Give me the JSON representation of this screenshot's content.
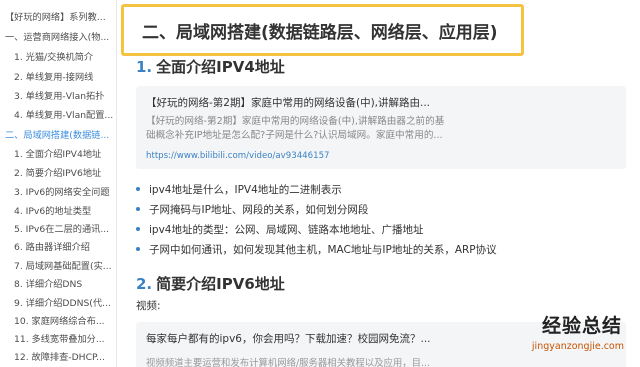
{
  "sidebar": {
    "items": [
      {
        "label": "【好玩的网络】系列教...",
        "level": 1,
        "active": false
      },
      {
        "label": "一、运营商网络接入(物...",
        "level": 1,
        "active": false
      },
      {
        "label": "1. 光猫/交换机简介",
        "level": 2,
        "active": false
      },
      {
        "label": "2. 单线复用-接网线",
        "level": 2,
        "active": false
      },
      {
        "label": "3. 单线复用-Vlan拓扑",
        "level": 2,
        "active": false
      },
      {
        "label": "4. 单线复用-Vlan配置...",
        "level": 2,
        "active": false
      },
      {
        "label": "二、局域网搭建(数据链...",
        "level": 1,
        "active": true
      },
      {
        "label": "1. 全面介绍IPV4地址",
        "level": 2,
        "active": false
      },
      {
        "label": "2. 简要介绍IPV6地址",
        "level": 2,
        "active": false
      },
      {
        "label": "3. IPv6的网络安全问题",
        "level": 2,
        "active": false
      },
      {
        "label": "4. IPv6的地址类型",
        "level": 2,
        "active": false
      },
      {
        "label": "5. IPv6在二层的通讯...",
        "level": 2,
        "active": false
      },
      {
        "label": "6. 路由器详细介绍",
        "level": 2,
        "active": false
      },
      {
        "label": "7. 局域网基础配置(实...",
        "level": 2,
        "active": false
      },
      {
        "label": "8. 详细介绍DNS",
        "level": 2,
        "active": false
      },
      {
        "label": "9. 详细介绍DDNS(代...",
        "level": 2,
        "active": false
      },
      {
        "label": "10. 家庭网络综合布...",
        "level": 2,
        "active": false
      },
      {
        "label": "11. 多线宽带叠加分...",
        "level": 2,
        "active": false
      },
      {
        "label": "12. 故障排查-DHCP...",
        "level": 2,
        "active": false
      }
    ]
  },
  "main": {
    "heading": "二、局域网搭建(数据链路层、网络层、应用层)",
    "section1": {
      "num": "1.",
      "title": "全面介绍IPV4地址"
    },
    "card": {
      "title": "【好玩的网络-第2期】家庭中常用的网络设备(中),讲解路由...",
      "desc": "【好玩的网络-第2期】家庭中常用的网络设备(中),讲解路由器之前的基础概念补充IP地址是怎么配?子网是什么?认识局域网。家庭中常用的...",
      "url": "https://www.bilibili.com/video/av93446157"
    },
    "bullets": [
      "ipv4地址是什么，IPV4地址的二进制表示",
      "子网掩码与IP地址、网段的关系，如何划分网段",
      "ipv4地址的类型：公网、局域网、链路本地地址、广播地址",
      "子网中如何通讯，如何发现其他主机，MAC地址与IP地址的关系，ARP协议"
    ],
    "section2": {
      "num": "2.",
      "title": "简要介绍IPV6地址"
    },
    "video_label": "视频:",
    "card2": {
      "title": "每家每户都有的ipv6，你会用吗？下载加速？校园网免流？...",
      "desc": "视频频道主要运营和发布计算机网络/服务器相关教程以及应用，目..."
    }
  },
  "watermark": {
    "cn": "经验总结",
    "py": "jingyanzongjie.com"
  },
  "colors": {
    "accent": "#3b82c4",
    "highlight_border": "#f5c242",
    "card_bg": "#f4f5f7",
    "sidebar_active": "#3b8ee0"
  }
}
